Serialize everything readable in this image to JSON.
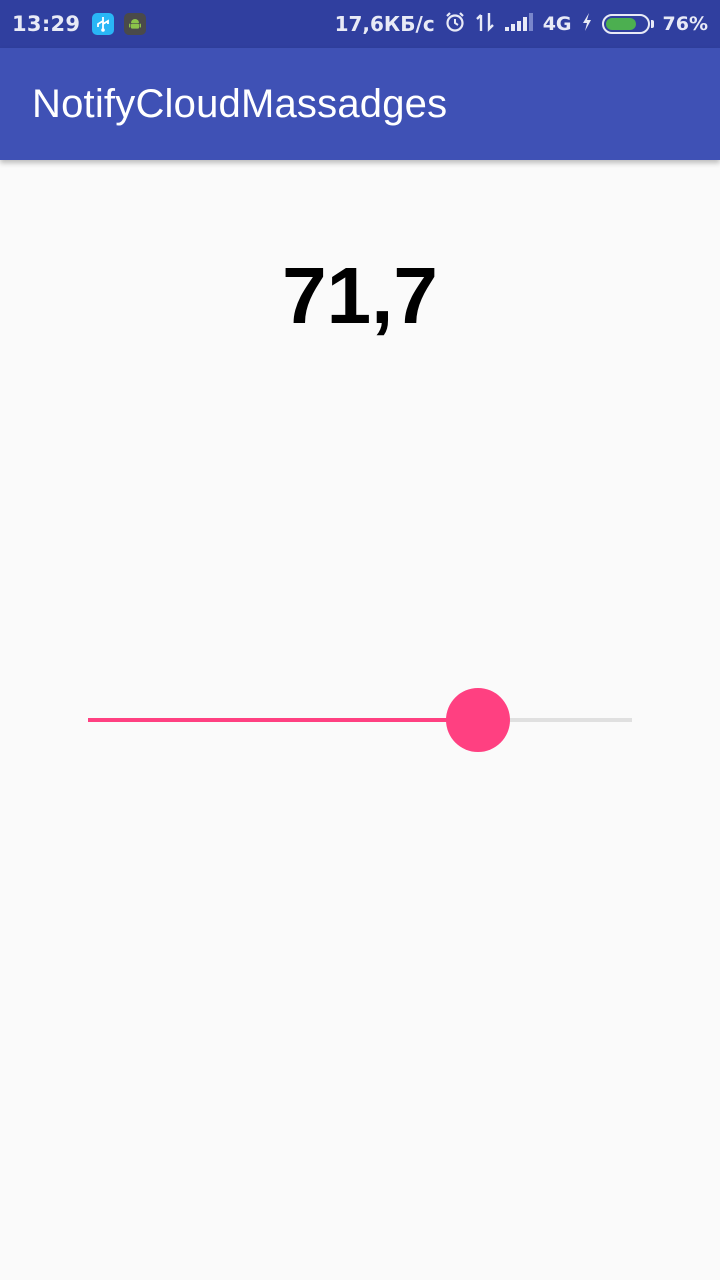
{
  "status_bar": {
    "time": "13:29",
    "notification_icons": [
      "usb-debug-icon",
      "android-icon"
    ],
    "network_speed": "17,6КБ/с",
    "icons": [
      "alarm-icon",
      "data-transfer-icon",
      "signal-icon"
    ],
    "network_type": "4G",
    "battery_level": 0.76,
    "battery_text": "76%",
    "charging": true
  },
  "app_bar": {
    "title": "NotifyCloudMassadges",
    "color": "#3f51b5"
  },
  "main": {
    "value_text": "71,7",
    "slider": {
      "progress": 0.717,
      "accent_color": "#ff4081",
      "track_color": "#e0e0e0"
    }
  }
}
